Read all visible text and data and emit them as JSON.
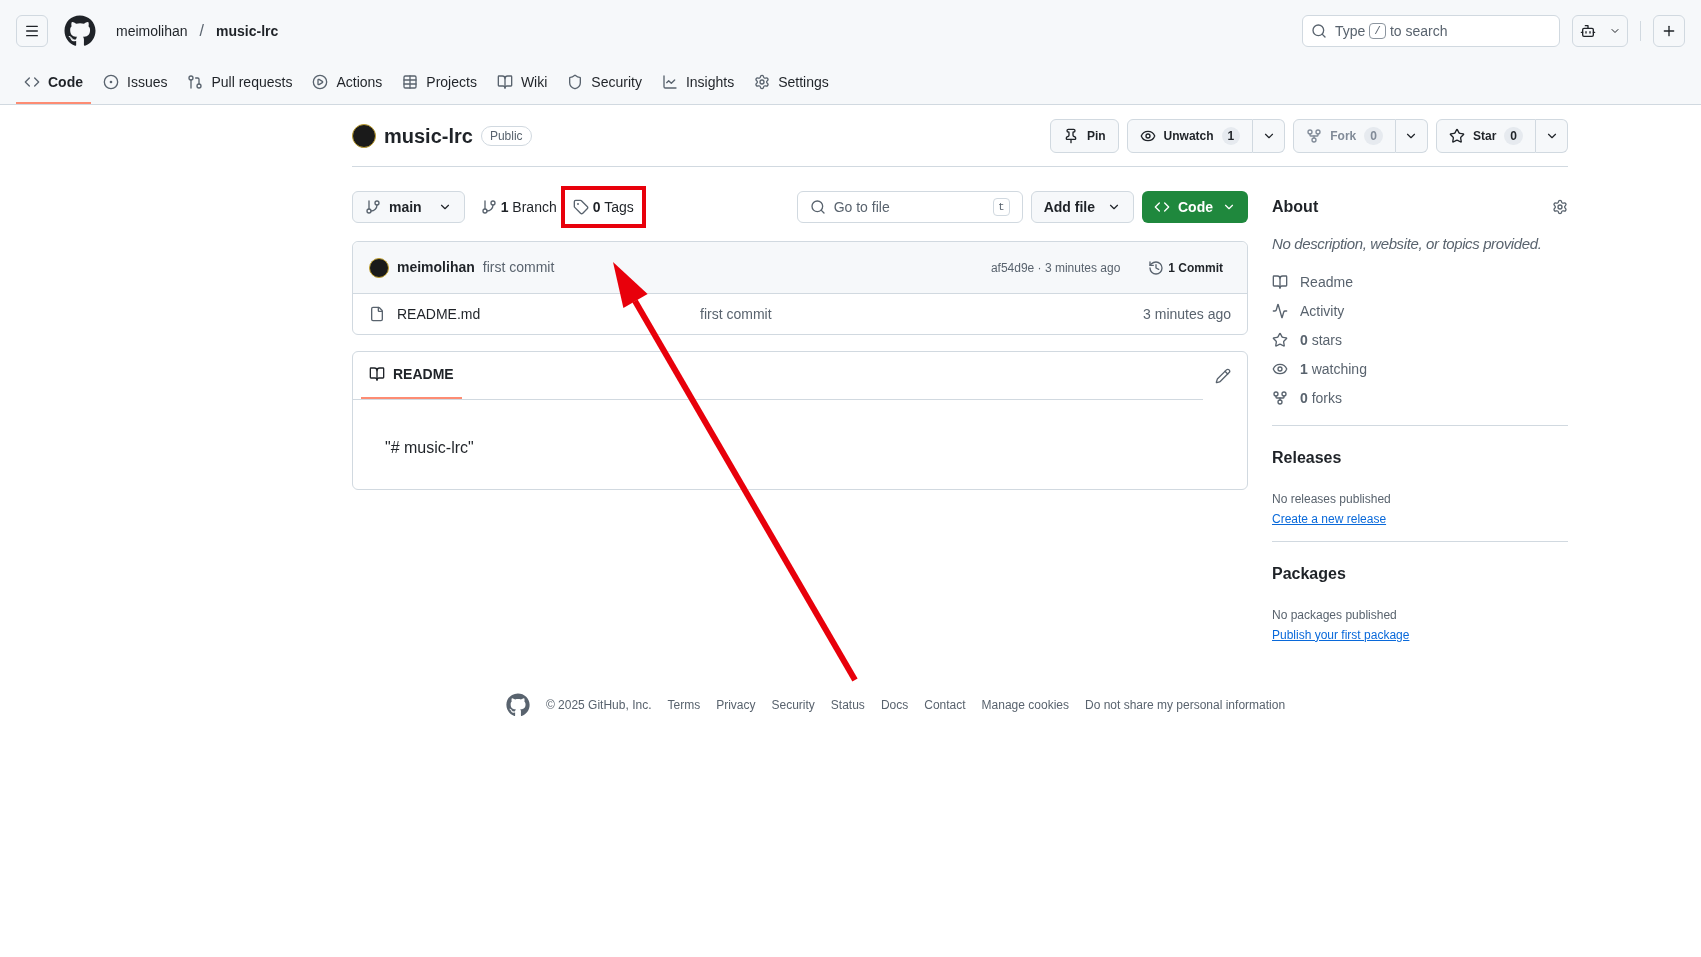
{
  "header": {
    "owner": "meimolihan",
    "separator": "/",
    "repo": "music-lrc",
    "search": {
      "prefix": "Type",
      "key": "/",
      "suffix": "to search"
    }
  },
  "nav_tabs": [
    {
      "kind": "code",
      "label": "Code",
      "selected": true
    },
    {
      "kind": "issues",
      "label": "Issues",
      "selected": false
    },
    {
      "kind": "pulls",
      "label": "Pull requests",
      "selected": false
    },
    {
      "kind": "actions",
      "label": "Actions",
      "selected": false
    },
    {
      "kind": "projects",
      "label": "Projects",
      "selected": false
    },
    {
      "kind": "wiki",
      "label": "Wiki",
      "selected": false
    },
    {
      "kind": "security",
      "label": "Security",
      "selected": false
    },
    {
      "kind": "insights",
      "label": "Insights",
      "selected": false
    },
    {
      "kind": "settings",
      "label": "Settings",
      "selected": false
    }
  ],
  "repo": {
    "name": "music-lrc",
    "visibility": "Public"
  },
  "repo_actions": [
    {
      "kind": "pin",
      "label": "Pin",
      "disabled": false
    },
    {
      "kind": "watch",
      "label": "Unwatch",
      "count": "1",
      "disabled": false
    },
    {
      "kind": "fork",
      "label": "Fork",
      "count": "0",
      "disabled": true
    },
    {
      "kind": "star",
      "label": "Star",
      "count": "0",
      "disabled": false
    }
  ],
  "toolbar": {
    "branch": "main",
    "branches": "**1** Branch",
    "tags": {
      "label": "**0** Tags",
      "highlighted": true
    },
    "file_search": {
      "placeholder": "Go to file",
      "key": "t"
    },
    "add_file": "Add file",
    "code": "Code"
  },
  "latest_commit": {
    "author": "meimolihan",
    "message": "first commit",
    "hash_time": "af54d9e · 3 minutes ago",
    "commits": "1 Commit"
  },
  "files": [
    {
      "name": "README.md",
      "message": "first commit",
      "time": "3 minutes ago"
    }
  ],
  "readme": {
    "tab": "README",
    "content": "\"# music-lrc\""
  },
  "about": {
    "title": "About",
    "description": "No description, website, or topics provided.",
    "items": [
      {
        "kind": "readme",
        "label": "Readme"
      },
      {
        "kind": "activity",
        "label": "Activity"
      },
      {
        "kind": "stars",
        "label": "**0** stars"
      },
      {
        "kind": "watching",
        "label": "**1** watching"
      },
      {
        "kind": "forks",
        "label": "**0** forks"
      }
    ]
  },
  "releases": {
    "title": "Releases",
    "note": "No releases published",
    "link": "Create a new release"
  },
  "packages": {
    "title": "Packages",
    "note": "No packages published",
    "link": "Publish your first package"
  },
  "footer": {
    "copyright": "© 2025 GitHub, Inc.",
    "links": [
      "Terms",
      "Privacy",
      "Security",
      "Status",
      "Docs",
      "Contact",
      "Manage cookies",
      "Do not share my personal information"
    ]
  }
}
